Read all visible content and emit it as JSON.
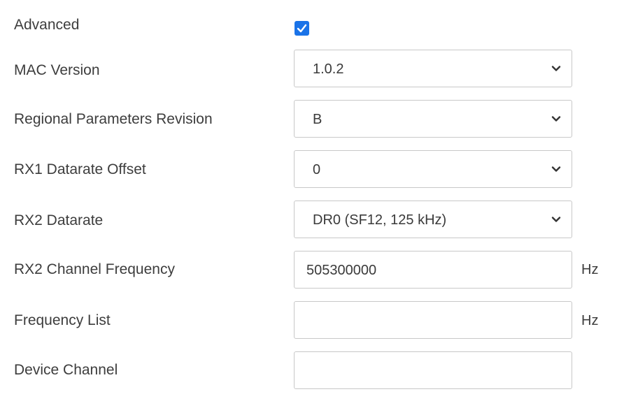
{
  "form": {
    "advanced": {
      "label": "Advanced",
      "checked": true
    },
    "mac_version": {
      "label": "MAC Version",
      "value": "1.0.2"
    },
    "regional_parameters_revision": {
      "label": "Regional Parameters Revision",
      "value": "B"
    },
    "rx1_datarate_offset": {
      "label": "RX1 Datarate Offset",
      "value": "0"
    },
    "rx2_datarate": {
      "label": "RX2 Datarate",
      "value": "DR0 (SF12, 125 kHz)"
    },
    "rx2_channel_frequency": {
      "label": "RX2 Channel Frequency",
      "value": "505300000",
      "unit": "Hz"
    },
    "frequency_list": {
      "label": "Frequency List",
      "value": "",
      "unit": "Hz"
    },
    "device_channel": {
      "label": "Device Channel",
      "value": ""
    }
  },
  "icons": {
    "checkbox": "checkmark-icon",
    "select": "chevron-down-icon"
  },
  "colors": {
    "checkbox_fill": "#1a73e8",
    "border": "#c8c8c8",
    "text": "#3d3d3d"
  }
}
